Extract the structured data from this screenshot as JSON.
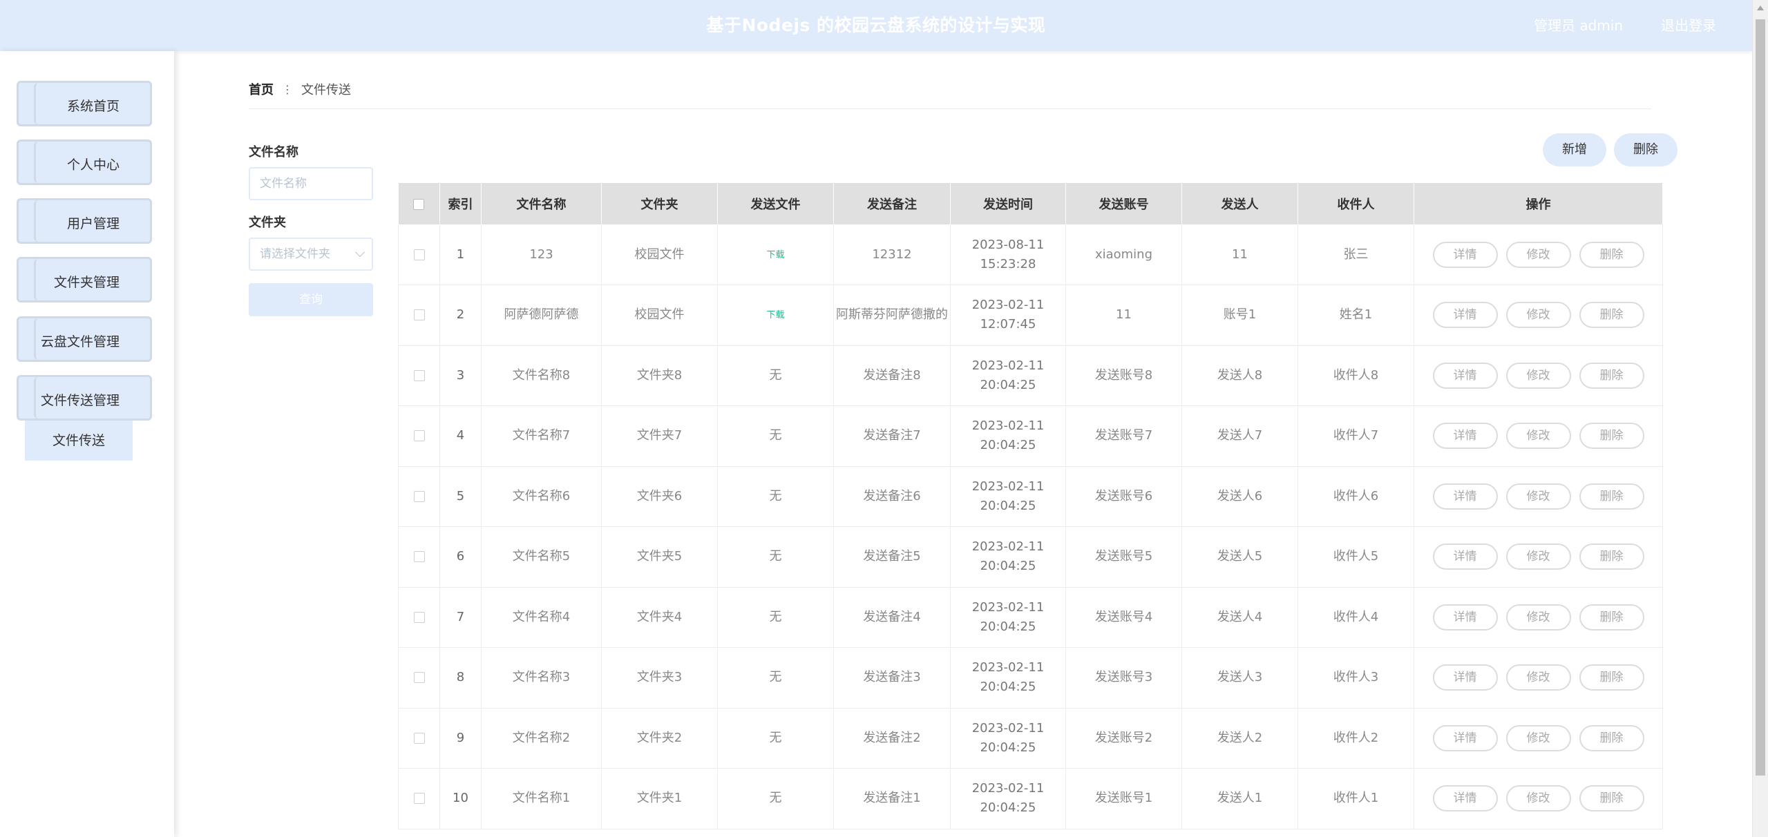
{
  "header": {
    "title": "基于Nodejs 的校园云盘系统的设计与实现",
    "user_label": "管理员 admin",
    "logout_label": "退出登录"
  },
  "sidebar": {
    "items": [
      {
        "label": "系统首页"
      },
      {
        "label": "个人中心"
      },
      {
        "label": "用户管理"
      },
      {
        "label": "文件夹管理"
      },
      {
        "label": "云盘文件管理"
      },
      {
        "label": "文件传送管理"
      }
    ],
    "submenu": {
      "label": "文件传送"
    }
  },
  "breadcrumb": {
    "home": "首页",
    "separator": "⋮",
    "current": "文件传送"
  },
  "search": {
    "name_label": "文件名称",
    "name_placeholder": "文件名称",
    "folder_label": "文件夹",
    "folder_placeholder": "请选择文件夹",
    "query_label": "查询"
  },
  "actions": {
    "add_label": "新增",
    "delete_label": "删除"
  },
  "table": {
    "headers": [
      "索引",
      "文件名称",
      "文件夹",
      "发送文件",
      "发送备注",
      "发送时间",
      "发送账号",
      "发送人",
      "收件人",
      "操作"
    ],
    "op_labels": {
      "detail": "详情",
      "edit": "修改",
      "delete": "删除"
    },
    "rows": [
      {
        "index": "1",
        "name": "123",
        "folder": "校园文件",
        "file": "下载",
        "note": "12312",
        "time": "2023-08-11 15:23:28",
        "account": "xiaoming",
        "sender": "11",
        "receiver": "张三"
      },
      {
        "index": "2",
        "name": "阿萨德阿萨德",
        "folder": "校园文件",
        "file": "下载",
        "note": "阿斯蒂芬阿萨德撒的",
        "time": "2023-02-11 12:07:45",
        "account": "11",
        "sender": "账号1",
        "receiver": "姓名1"
      },
      {
        "index": "3",
        "name": "文件名称8",
        "folder": "文件夹8",
        "file": "无",
        "note": "发送备注8",
        "time": "2023-02-11 20:04:25",
        "account": "发送账号8",
        "sender": "发送人8",
        "receiver": "收件人8"
      },
      {
        "index": "4",
        "name": "文件名称7",
        "folder": "文件夹7",
        "file": "无",
        "note": "发送备注7",
        "time": "2023-02-11 20:04:25",
        "account": "发送账号7",
        "sender": "发送人7",
        "receiver": "收件人7"
      },
      {
        "index": "5",
        "name": "文件名称6",
        "folder": "文件夹6",
        "file": "无",
        "note": "发送备注6",
        "time": "2023-02-11 20:04:25",
        "account": "发送账号6",
        "sender": "发送人6",
        "receiver": "收件人6"
      },
      {
        "index": "6",
        "name": "文件名称5",
        "folder": "文件夹5",
        "file": "无",
        "note": "发送备注5",
        "time": "2023-02-11 20:04:25",
        "account": "发送账号5",
        "sender": "发送人5",
        "receiver": "收件人5"
      },
      {
        "index": "7",
        "name": "文件名称4",
        "folder": "文件夹4",
        "file": "无",
        "note": "发送备注4",
        "time": "2023-02-11 20:04:25",
        "account": "发送账号4",
        "sender": "发送人4",
        "receiver": "收件人4"
      },
      {
        "index": "8",
        "name": "文件名称3",
        "folder": "文件夹3",
        "file": "无",
        "note": "发送备注3",
        "time": "2023-02-11 20:04:25",
        "account": "发送账号3",
        "sender": "发送人3",
        "receiver": "收件人3"
      },
      {
        "index": "9",
        "name": "文件名称2",
        "folder": "文件夹2",
        "file": "无",
        "note": "发送备注2",
        "time": "2023-02-11 20:04:25",
        "account": "发送账号2",
        "sender": "发送人2",
        "receiver": "收件人2"
      },
      {
        "index": "10",
        "name": "文件名称1",
        "folder": "文件夹1",
        "file": "无",
        "note": "发送备注1",
        "time": "2023-02-11 20:04:25",
        "account": "发送账号1",
        "sender": "发送人1",
        "receiver": "收件人1"
      }
    ]
  },
  "colors": {
    "accent_light": "#dfeafb",
    "download_link": "#1fb98d",
    "header_text": "#ffffff"
  }
}
